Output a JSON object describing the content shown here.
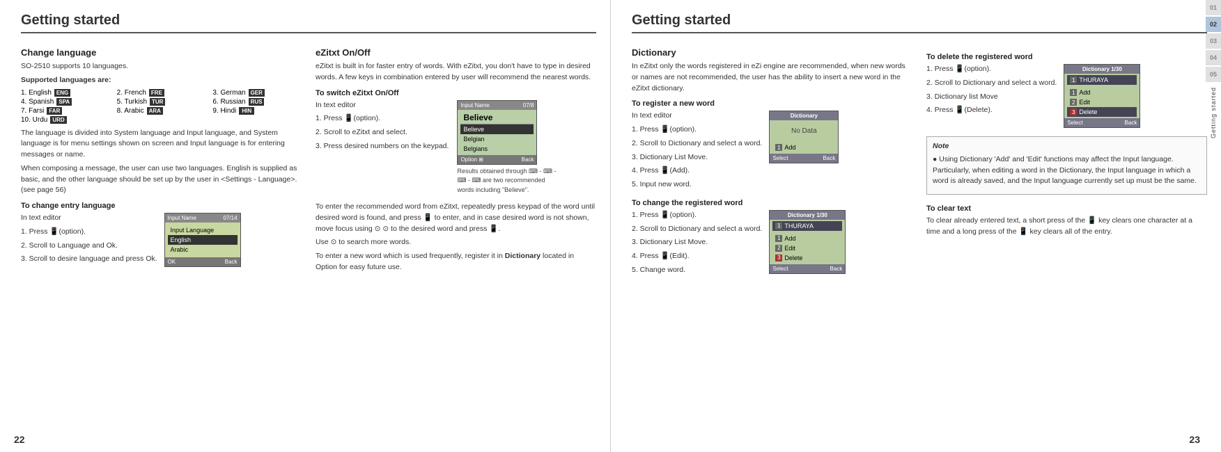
{
  "leftPage": {
    "title": "Getting started",
    "pageNumber": "22",
    "changeLanguage": {
      "title": "Change language",
      "intro": "SO-2510 supports 10 languages.",
      "supportedLabel": "Supported languages are:",
      "languages": [
        {
          "num": "1.",
          "name": "English",
          "badge": "ENG"
        },
        {
          "num": "2.",
          "name": "French",
          "badge": "FRE"
        },
        {
          "num": "3.",
          "name": "German",
          "badge": "GER"
        },
        {
          "num": "4.",
          "name": "Spanish",
          "badge": "SPA"
        },
        {
          "num": "5.",
          "name": "Turkish",
          "badge": "TUR"
        },
        {
          "num": "6.",
          "name": "Russian",
          "badge": "RUS"
        },
        {
          "num": "7.",
          "name": "Farsi",
          "badge": "FAR"
        },
        {
          "num": "8.",
          "name": "Arabic",
          "badge": "ARA"
        },
        {
          "num": "9.",
          "name": "Hindi",
          "badge": "HIN"
        },
        {
          "num": "10.",
          "name": "Urdu",
          "badge": "URD"
        }
      ],
      "desc1": "The language is divided into System language and Input language, and System language is for menu settings shown on screen and Input language is for entering messages or name.",
      "desc2": "When composing a message, the user can use two languages. English is supplied as basic, and the other language should be set up by the user in <Settings - Language>. (see page 56)",
      "changeEntryTitle": "To change entry language",
      "changeEntrySteps": [
        "In text editor",
        "1. Press 📱(option).",
        "2. Scroll to Language and Ok.",
        "3. Scroll to desire language and press Ok."
      ]
    },
    "phoneScreen1": {
      "header": "Input Name",
      "headerRight": "07/14",
      "item1": "Input Language",
      "item2Selected": "English",
      "item3": "Arabic",
      "footerLeft": "OK",
      "footerRight": "Back"
    },
    "eZitxt": {
      "title": "eZitxt On/Off",
      "desc": "eZitxt is built in for faster entry of words. With eZitxt, you don't have to type in desired words. A few keys in combination entered by user will recommend the nearest words.",
      "switchTitle": "To switch eZitxt On/Off",
      "steps": [
        "In text editor",
        "1. Press 📱(option).",
        "2. Scroll to eZitxt and select.",
        "3. Press desired numbers on the keypad."
      ],
      "inputScreen": {
        "header": "Input Name",
        "headerRight": "07/8",
        "inputText": "Believe",
        "item1": "Believe",
        "item2": "Belgian",
        "item3": "Belgians",
        "footerLeft": "Option",
        "footerLeftIcon": "⊞",
        "footerRight": "Back"
      },
      "resultNote": "Results obtained through ⌨ - ⌨ - ⌨ - ⌨ are two recommended words including \"Believe\".",
      "toEnterDesc": "To enter the recommended word from eZitxt, repeatedly press keypad of the word until desired word is found, and press 📱 to enter, and in case desired word is not shown, move focus using ⊙ ⊙ to the desired word and press 📱.",
      "useDesc": "Use ⊙ to search more words.",
      "toEnterNewWord": "To enter a new word which is used frequently, register it in Dictionary located in Option for easy future use."
    }
  },
  "rightPage": {
    "title": "Getting started",
    "pageNumber": "23",
    "dictionary": {
      "title": "Dictionary",
      "intro": "In eZitxt only the words registered in eZi engine are recommended, when new words or names are not recommended, the user has the ability to insert a new word in the eZitxt dictionary.",
      "registerTitle": "To register a new word",
      "registerSteps": [
        "In text editor",
        "1. Press 📱(option).",
        "2. Scroll to Dictionary and select a word.",
        "3. Dictionary List Move.",
        "4. Press 📱(Add).",
        "5. Input new word."
      ],
      "changeTitle": "To change the registered word",
      "changeSteps": [
        "1. Press 📱(option).",
        "2. Scroll to Dictionary and select a word.",
        "3. Dictionary List Move.",
        "4. Press 📱(Edit).",
        "5. Change word."
      ],
      "dictScreen1": {
        "header": "Dictionary",
        "noData": "No Data",
        "item1": "Add",
        "footerLeft": "Select",
        "footerRight": "Back"
      },
      "dictScreen2": {
        "header": "Dictionary 1/30",
        "item1": "THURAYA",
        "item1num": "1",
        "add": "Add",
        "edit": "Edit",
        "delete": "Delete",
        "footerLeft": "Select",
        "footerRight": "Back"
      }
    },
    "deleteTitle": "To delete the registered word",
    "deleteSteps": [
      "1. Press 📱(option).",
      "2. Scroll to Dictionary and select a word.",
      "3. Dictionary list Move",
      "4. Press 📱(Delete)."
    ],
    "deleteScreen": {
      "header": "Dictionary 1/30",
      "item1": "THURAYA",
      "item1num": "1",
      "add": "Add",
      "edit": "Edit",
      "delete": "Delete",
      "deleteSelected": true,
      "footerLeft": "Select",
      "footerRight": "Back"
    },
    "note": {
      "title": "Note",
      "text": "Using Dictionary 'Add' and 'Edit' functions may affect the Input language. Particularly, when editing a word in the Dictionary, the Input language in which a word is already saved, and the Input language currently set up must be the same."
    },
    "clearText": {
      "title": "To clear text",
      "desc": "To clear already entered text, a short press of the 📱 key clears one character at a time and a long press of the 📱 key clears all of the entry."
    }
  },
  "sideTab": {
    "numbers": [
      "01",
      "02",
      "03",
      "04",
      "05"
    ],
    "activeIndex": 1,
    "verticalText": "Getting started"
  }
}
